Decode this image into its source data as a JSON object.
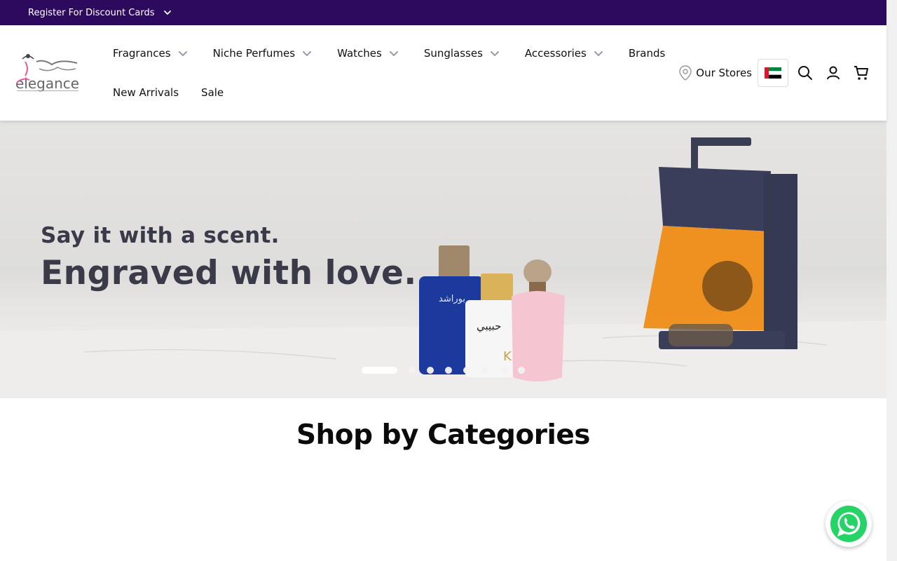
{
  "topbar": {
    "discount_label": "Register For Discount Cards",
    "bg_color": "#2d0a5e"
  },
  "header": {
    "logo_alt": "elegance style",
    "nav": [
      {
        "label": "Fragrances",
        "has_dropdown": true
      },
      {
        "label": "Niche Perfumes",
        "has_dropdown": true
      },
      {
        "label": "Watches",
        "has_dropdown": true
      },
      {
        "label": "Sunglasses",
        "has_dropdown": true
      },
      {
        "label": "Accessories",
        "has_dropdown": true
      },
      {
        "label": "Brands",
        "has_dropdown": false
      },
      {
        "label": "New Arrivals",
        "has_dropdown": false
      },
      {
        "label": "Sale",
        "has_dropdown": false
      }
    ],
    "stores_label": "Our Stores",
    "country_flag": "uae-flag-icon",
    "icons": [
      "search-icon",
      "user-icon",
      "cart-icon"
    ]
  },
  "hero": {
    "line1": "Say it with a scent.",
    "line2": "Engraved with love.",
    "slide_count": 8,
    "active_slide": 1
  },
  "sections": {
    "categories_title": "Shop by Categories"
  },
  "floating": {
    "whatsapp_icon": "whatsapp-icon",
    "whatsapp_color": "#25d366"
  }
}
